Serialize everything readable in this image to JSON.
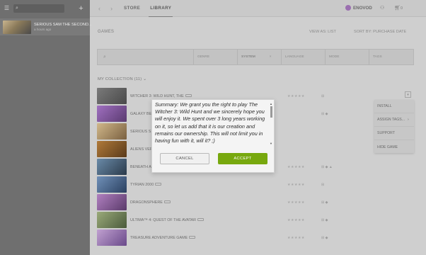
{
  "sidebar": {
    "search_placeholder": "",
    "recent_game": {
      "title": "SERIOUS SAM THE SECOND...",
      "subtitle": "a hours ago"
    }
  },
  "topbar": {
    "store_label": "STORE",
    "library_label": "LIBRARY",
    "username": "ENOVOD",
    "cart_count": "0"
  },
  "library": {
    "heading": "GAMES",
    "view_as_label": "VIEW AS: LIST",
    "sort_by_label": "SORT BY: PURCHASE DATE",
    "collection_label": "MY COLLECTION (11)"
  },
  "filters": {
    "search_placeholder": "",
    "columns": [
      "GENRE",
      "SYSTEM",
      "LANGUAGE",
      "MODE",
      "TAGS"
    ]
  },
  "games": [
    {
      "name": "WITCHER 3: WILD HUNT, THE",
      "rating": "★★★★★",
      "platform": "⊞",
      "thumb": "#5c5c5c"
    },
    {
      "name": "GALAXY BE",
      "rating": "",
      "platform": "⊞ ◆",
      "thumb": "#7a4a8a"
    },
    {
      "name": "SERIOUS S",
      "rating": "",
      "platform": "",
      "thumb": "#a89064"
    },
    {
      "name": "ALIENS VER",
      "rating": "",
      "platform": "",
      "thumb": "#8c5a2a"
    },
    {
      "name": "BENEATH A",
      "rating": "★★★★★",
      "platform": "⊞ ◆ ▲",
      "thumb": "#3f5e7a"
    },
    {
      "name": "TYRIAN 2000",
      "rating": "★★★★★",
      "platform": "⊞",
      "thumb": "#4a6a8f"
    },
    {
      "name": "DRAGONSPHERE",
      "rating": "★★★★★",
      "platform": "⊞ ◆",
      "thumb": "#8a5a9a"
    },
    {
      "name": "ULTIMA™ 4: QUEST OF THE AVATAR",
      "rating": "★★★★★",
      "platform": "⊞ ◆",
      "thumb": "#6a7a5a"
    },
    {
      "name": "TREASURE ADVENTURE GAME",
      "rating": "★★★★★",
      "platform": "⊞ ◆",
      "thumb": "#8a6a9a"
    }
  ],
  "context_menu": {
    "items": [
      "INSTALL",
      "ASSIGN TAGS...",
      "SUPPORT",
      "HIDE GAME"
    ]
  },
  "dialog": {
    "text": "Summary: We grant you the right to play The Witcher 3: Wild Hunt and we sincerely hope you will enjoy it. We spent over 3 long years working on it, so let us add that it is our creation and remains our ownership. This will not limit you in having fun with it, will it? ;)",
    "cancel_label": "CANCEL",
    "accept_label": "ACCEPT"
  }
}
